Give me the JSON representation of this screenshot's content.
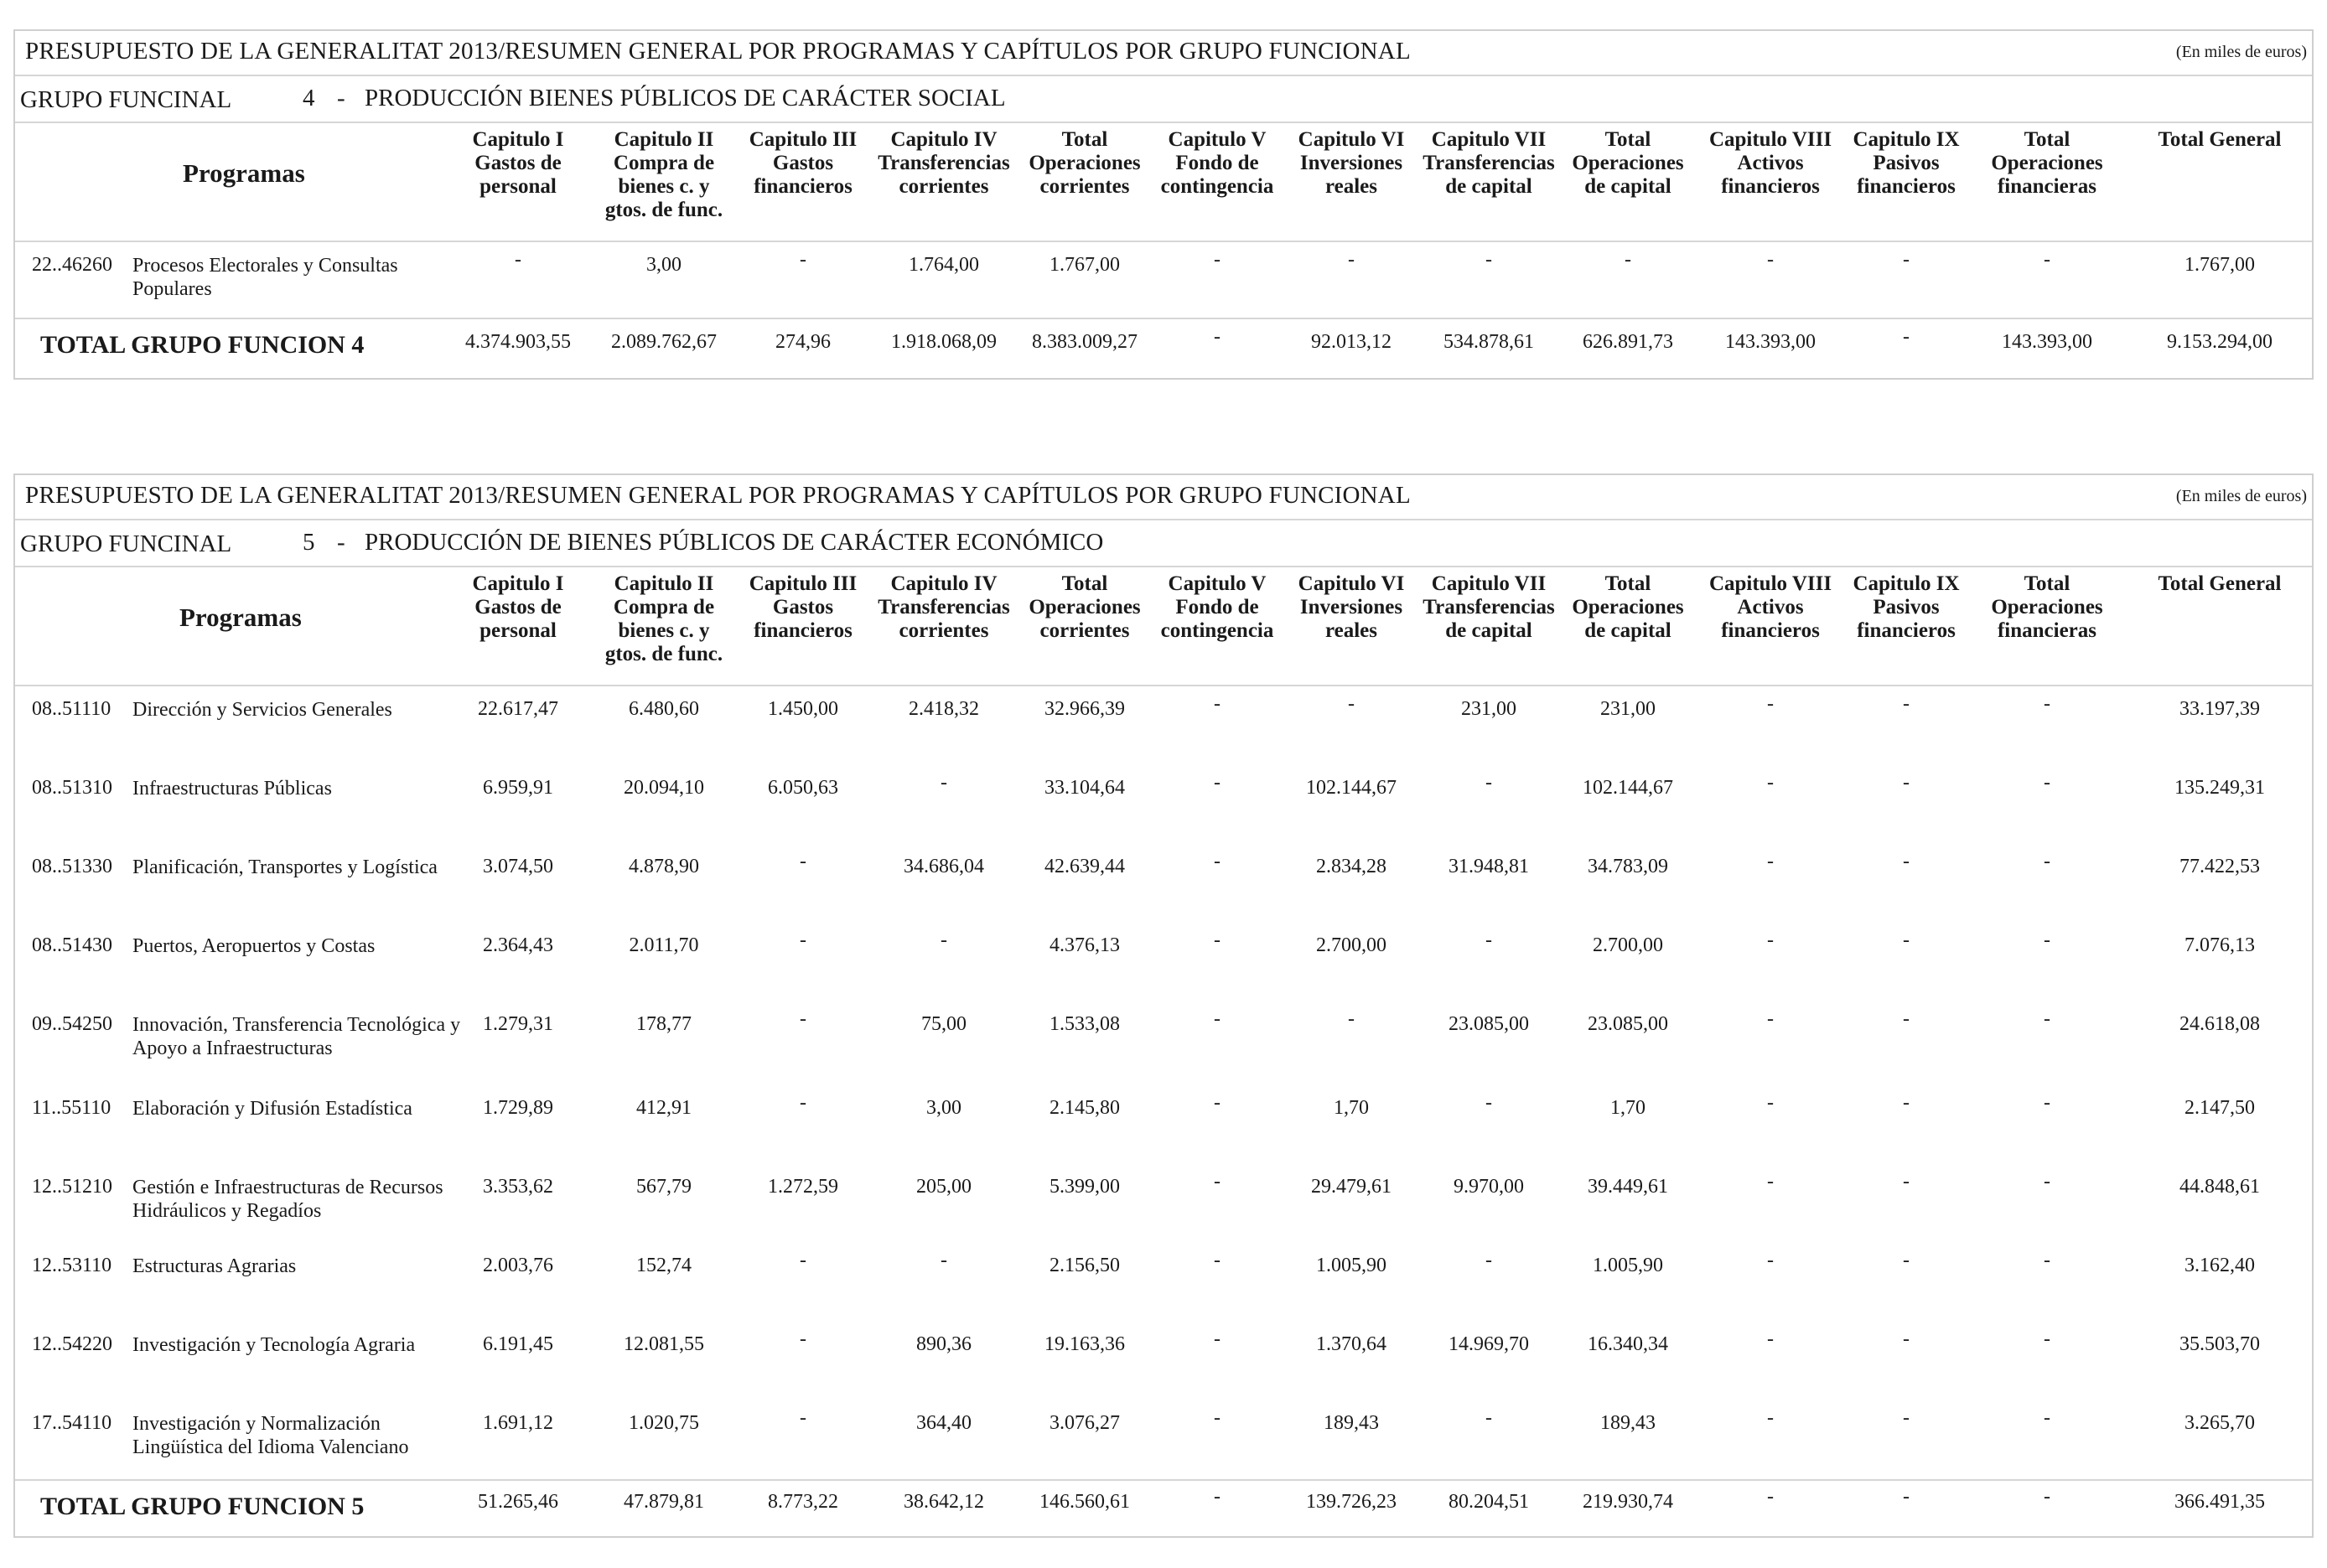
{
  "columns": [
    [
      "Capitulo I",
      "Gastos de",
      "personal"
    ],
    [
      "Capitulo II",
      "Compra de",
      "bienes c. y",
      "gtos. de func."
    ],
    [
      "Capitulo III",
      "Gastos",
      "financieros"
    ],
    [
      "Capitulo IV",
      "Transferencias",
      "corrientes"
    ],
    [
      "Total",
      "Operaciones",
      "corrientes"
    ],
    [
      "Capitulo V",
      "Fondo de",
      "contingencia"
    ],
    [
      "Capitulo VI",
      "Inversiones",
      "reales"
    ],
    [
      "Capitulo VII",
      "Transferencias",
      "de capital"
    ],
    [
      "Total",
      "Operaciones",
      "de capital"
    ],
    [
      "Capitulo VIII",
      "Activos",
      "financieros"
    ],
    [
      "Capitulo IX",
      "Pasivos",
      "financieros"
    ],
    [
      "Total",
      "Operaciones",
      "financieras"
    ],
    [
      "Total General"
    ]
  ],
  "programs_header": "Programas",
  "sections": [
    {
      "title": "PRESUPUESTO DE LA GENERALITAT 2013/RESUMEN GENERAL POR PROGRAMAS Y CAPÍTULOS POR GRUPO FUNCIONAL",
      "units": "(En miles de euros)",
      "group_label": "GRUPO FUNCINAL",
      "group_number": "4",
      "group_dash": "-",
      "group_name": "PRODUCCIÓN BIENES PÚBLICOS DE CARÁCTER SOCIAL",
      "rows": [
        {
          "code": "22..46260",
          "name": "Procesos Electorales y Consultas Populares",
          "values": [
            "-",
            "3,00",
            "-",
            "1.764,00",
            "1.767,00",
            "-",
            "-",
            "-",
            "-",
            "-",
            "-",
            "-",
            "1.767,00"
          ]
        }
      ],
      "total_label": "TOTAL GRUPO FUNCION  4",
      "total_values": [
        "4.374.903,55",
        "2.089.762,67",
        "274,96",
        "1.918.068,09",
        "8.383.009,27",
        "-",
        "92.013,12",
        "534.878,61",
        "626.891,73",
        "143.393,00",
        "-",
        "143.393,00",
        "9.153.294,00"
      ]
    },
    {
      "title": "PRESUPUESTO DE LA GENERALITAT 2013/RESUMEN GENERAL POR PROGRAMAS Y CAPÍTULOS POR GRUPO FUNCIONAL",
      "units": "(En miles de euros)",
      "group_label": "GRUPO FUNCINAL",
      "group_number": "5",
      "group_dash": "-",
      "group_name": "PRODUCCIÓN DE BIENES PÚBLICOS DE CARÁCTER ECONÓMICO",
      "rows": [
        {
          "code": "08..51110",
          "name": "Dirección y Servicios Generales",
          "values": [
            "22.617,47",
            "6.480,60",
            "1.450,00",
            "2.418,32",
            "32.966,39",
            "-",
            "-",
            "231,00",
            "231,00",
            "-",
            "-",
            "-",
            "33.197,39"
          ]
        },
        {
          "code": "08..51310",
          "name": "Infraestructuras Públicas",
          "values": [
            "6.959,91",
            "20.094,10",
            "6.050,63",
            "-",
            "33.104,64",
            "-",
            "102.144,67",
            "-",
            "102.144,67",
            "-",
            "-",
            "-",
            "135.249,31"
          ]
        },
        {
          "code": "08..51330",
          "name": "Planificación, Transportes y Logística",
          "values": [
            "3.074,50",
            "4.878,90",
            "-",
            "34.686,04",
            "42.639,44",
            "-",
            "2.834,28",
            "31.948,81",
            "34.783,09",
            "-",
            "-",
            "-",
            "77.422,53"
          ]
        },
        {
          "code": "08..51430",
          "name": "Puertos, Aeropuertos y Costas",
          "values": [
            "2.364,43",
            "2.011,70",
            "-",
            "-",
            "4.376,13",
            "-",
            "2.700,00",
            "-",
            "2.700,00",
            "-",
            "-",
            "-",
            "7.076,13"
          ]
        },
        {
          "code": "09..54250",
          "name": "Innovación, Transferencia Tecnológica y Apoyo a Infraestructuras",
          "values": [
            "1.279,31",
            "178,77",
            "-",
            "75,00",
            "1.533,08",
            "-",
            "-",
            "23.085,00",
            "23.085,00",
            "-",
            "-",
            "-",
            "24.618,08"
          ]
        },
        {
          "code": "11..55110",
          "name": "Elaboración y Difusión Estadística",
          "values": [
            "1.729,89",
            "412,91",
            "-",
            "3,00",
            "2.145,80",
            "-",
            "1,70",
            "-",
            "1,70",
            "-",
            "-",
            "-",
            "2.147,50"
          ]
        },
        {
          "code": "12..51210",
          "name": "Gestión e Infraestructuras de Recursos Hidráulicos y Regadíos",
          "values": [
            "3.353,62",
            "567,79",
            "1.272,59",
            "205,00",
            "5.399,00",
            "-",
            "29.479,61",
            "9.970,00",
            "39.449,61",
            "-",
            "-",
            "-",
            "44.848,61"
          ]
        },
        {
          "code": "12..53110",
          "name": "Estructuras Agrarias",
          "values": [
            "2.003,76",
            "152,74",
            "-",
            "-",
            "2.156,50",
            "-",
            "1.005,90",
            "-",
            "1.005,90",
            "-",
            "-",
            "-",
            "3.162,40"
          ]
        },
        {
          "code": "12..54220",
          "name": "Investigación y Tecnología Agraria",
          "values": [
            "6.191,45",
            "12.081,55",
            "-",
            "890,36",
            "19.163,36",
            "-",
            "1.370,64",
            "14.969,70",
            "16.340,34",
            "-",
            "-",
            "-",
            "35.503,70"
          ]
        },
        {
          "code": "17..54110",
          "name": "Investigación y Normalización Lingüística del Idioma Valenciano",
          "values": [
            "1.691,12",
            "1.020,75",
            "-",
            "364,40",
            "3.076,27",
            "-",
            "189,43",
            "-",
            "189,43",
            "-",
            "-",
            "-",
            "3.265,70"
          ]
        }
      ],
      "total_label": "TOTAL GRUPO FUNCION  5",
      "total_values": [
        "51.265,46",
        "47.879,81",
        "8.773,22",
        "38.642,12",
        "146.560,61",
        "-",
        "139.726,23",
        "80.204,51",
        "219.930,74",
        "-",
        "-",
        "-",
        "366.491,35"
      ]
    }
  ]
}
